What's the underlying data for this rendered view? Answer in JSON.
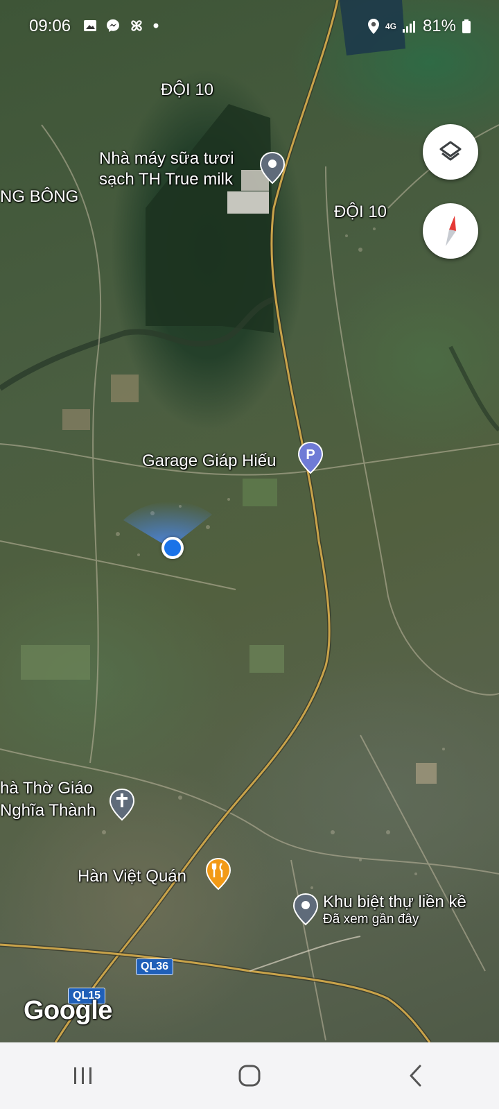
{
  "status_bar": {
    "time": "09:06",
    "network": "4G",
    "battery": "81%",
    "left_icons": [
      "gallery-icon",
      "messenger-icon",
      "pinwheel-icon",
      "dot-icon"
    ],
    "right_icons": [
      "location-icon",
      "signal-icon",
      "battery-icon"
    ]
  },
  "map": {
    "labels": {
      "doi10_top": "ĐỘI 10",
      "th_line1": "Nhà máy sữa tươi",
      "th_line2": "sạch TH True milk",
      "ng_bong": "NG BÔNG",
      "doi10_right": "ĐỘI 10",
      "garage": "Garage Giáp Hiếu",
      "church_line1": "hà Thờ Giáo",
      "church_line2": "Nghĩa Thành",
      "han_viet": "Hàn Việt Quán",
      "khu_biet_thu": "Khu biệt thự liền kề",
      "khu_sub": "Đã xem gần đây"
    },
    "road_shields": {
      "ql36": "QL36",
      "ql15": "QL15"
    },
    "attribution": "Google",
    "colors": {
      "road": "#c9a34a",
      "location": "#1a73e8",
      "pin_gray": "#5f6b7a",
      "parking": "#6f7bd6",
      "food": "#f29a16",
      "compass_red": "#e53935"
    }
  },
  "controls": {
    "layers_button": "layers-icon",
    "compass_button": "compass-icon"
  },
  "nav_bar": {
    "recents": "recents-icon",
    "home": "home-icon",
    "back": "back-icon"
  }
}
